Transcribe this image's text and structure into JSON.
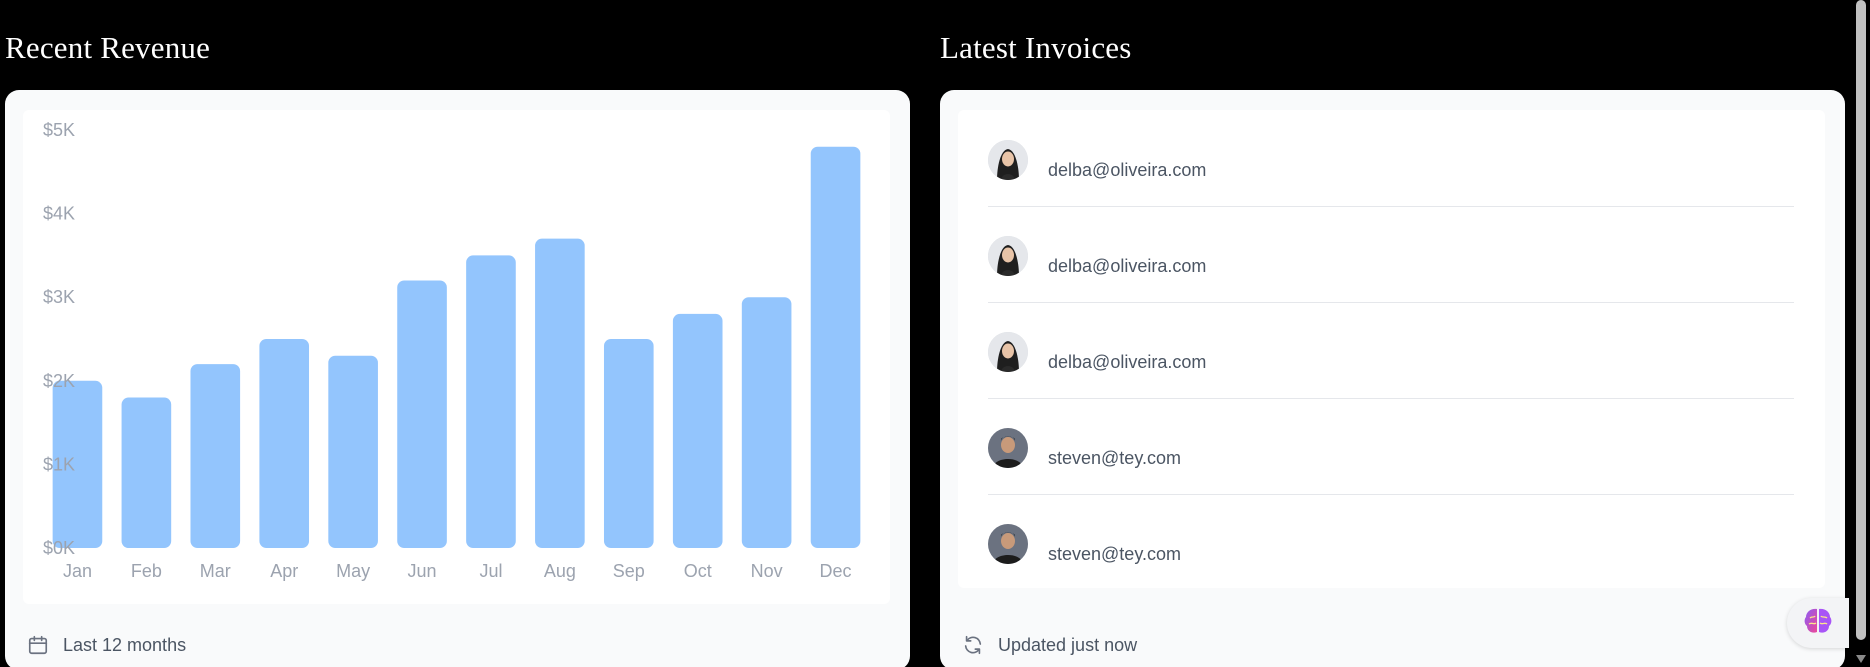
{
  "revenue": {
    "title": "Recent Revenue",
    "footer_label": "Last 12 months",
    "footer_icon": "calendar-icon"
  },
  "invoices": {
    "title": "Latest Invoices",
    "footer_label": "Updated just now",
    "footer_icon": "refresh-icon",
    "items": [
      {
        "email": "delba@oliveira.com",
        "avatar": "avatar-woman"
      },
      {
        "email": "delba@oliveira.com",
        "avatar": "avatar-woman"
      },
      {
        "email": "delba@oliveira.com",
        "avatar": "avatar-woman"
      },
      {
        "email": "steven@tey.com",
        "avatar": "avatar-man"
      },
      {
        "email": "steven@tey.com",
        "avatar": "avatar-man"
      }
    ]
  },
  "floating_button": {
    "icon": "brain-icon"
  },
  "colors": {
    "bar": "#93c5fd",
    "axis_text": "#9ca3af",
    "page_bg": "#000000",
    "card_bg": "#f9fafb"
  },
  "chart_data": {
    "type": "bar",
    "title": "",
    "xlabel": "",
    "ylabel": "",
    "categories": [
      "Jan",
      "Feb",
      "Mar",
      "Apr",
      "May",
      "Jun",
      "Jul",
      "Aug",
      "Sep",
      "Oct",
      "Nov",
      "Dec"
    ],
    "values": [
      2000,
      1800,
      2200,
      2500,
      2300,
      3200,
      3500,
      3700,
      2500,
      2800,
      3000,
      4800
    ],
    "ylim": [
      0,
      5000
    ],
    "y_tick_labels": [
      "$5K",
      "$4K",
      "$3K",
      "$2K",
      "$1K",
      "$0K"
    ],
    "y_tick_values": [
      5000,
      4000,
      3000,
      2000,
      1000,
      0
    ],
    "grid": false
  }
}
